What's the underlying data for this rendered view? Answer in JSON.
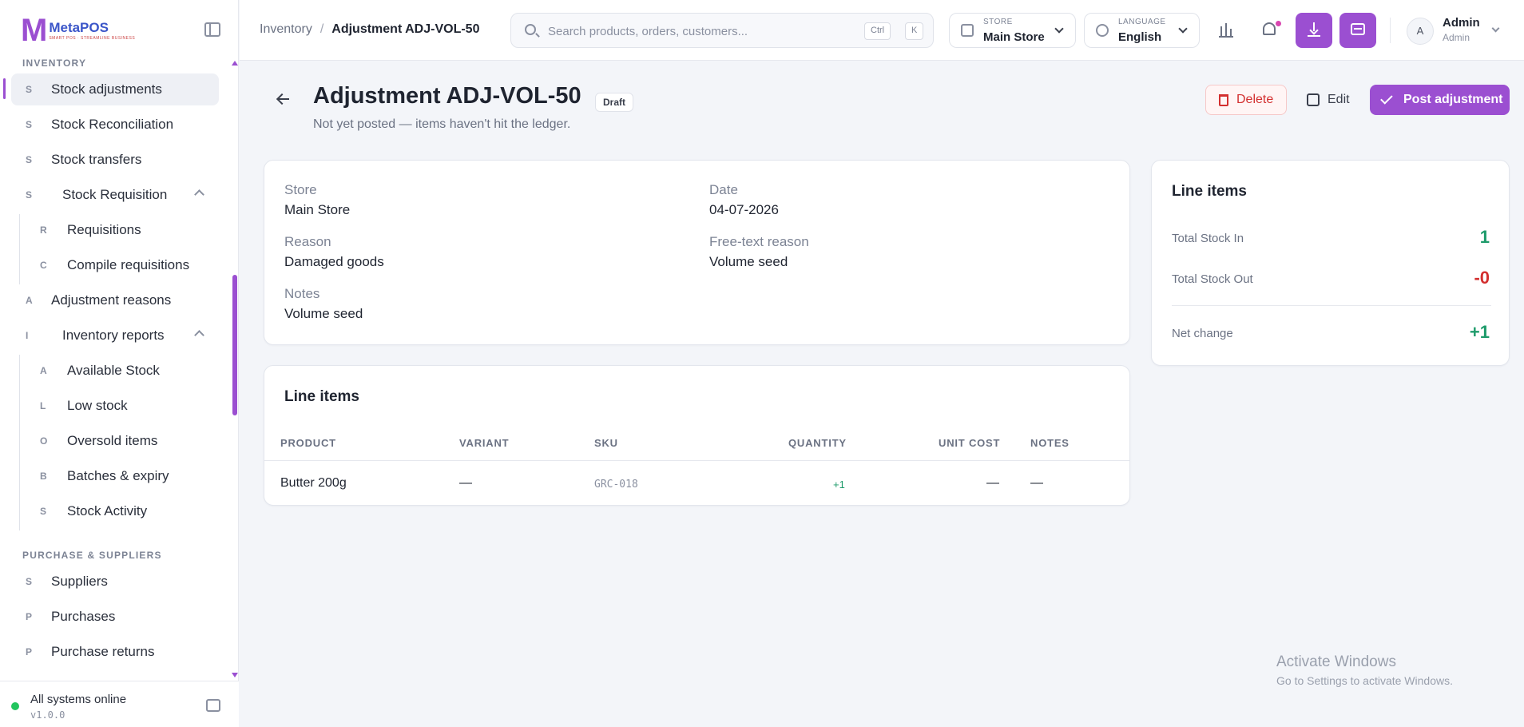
{
  "app": {
    "brand": "MetaPOS",
    "brand_tagline": "SMART POS · STREAMLINE BUSINESS",
    "logo_mark": "M"
  },
  "sidebar": {
    "section_inventory": "INVENTORY",
    "items": [
      {
        "letter": "S",
        "label": "Stock adjustments"
      },
      {
        "letter": "S",
        "label": "Stock Reconciliation"
      },
      {
        "letter": "S",
        "label": "Stock transfers"
      },
      {
        "letter": "S",
        "label": "Stock Requisition"
      },
      {
        "letter": "R",
        "label": "Requisitions"
      },
      {
        "letter": "C",
        "label": "Compile requisitions"
      },
      {
        "letter": "A",
        "label": "Adjustment reasons"
      },
      {
        "letter": "I",
        "label": "Inventory reports"
      },
      {
        "letter": "A",
        "label": "Available Stock"
      },
      {
        "letter": "L",
        "label": "Low stock"
      },
      {
        "letter": "O",
        "label": "Oversold items"
      },
      {
        "letter": "B",
        "label": "Batches & expiry"
      },
      {
        "letter": "S",
        "label": "Stock Activity"
      }
    ],
    "section_purchase": "PURCHASE & SUPPLIERS",
    "purchase_items": [
      {
        "letter": "S",
        "label": "Suppliers"
      },
      {
        "letter": "P",
        "label": "Purchases"
      },
      {
        "letter": "P",
        "label": "Purchase returns"
      }
    ],
    "status_label": "All systems online",
    "version": "v1.0.0"
  },
  "header": {
    "breadcrumb_parent": "Inventory",
    "breadcrumb_sep": "/",
    "breadcrumb_current": "Adjustment ADJ-VOL-50",
    "search_placeholder": "Search products, orders, customers...",
    "kbd_ctrl": "Ctrl",
    "kbd_k": "K",
    "store_label": "STORE",
    "store_value": "Main Store",
    "language_label": "LANGUAGE",
    "language_value": "English",
    "user_initial": "A",
    "user_name": "Admin",
    "user_role": "Admin"
  },
  "page": {
    "title": "Adjustment ADJ-VOL-50",
    "status_badge": "Draft",
    "subtitle": "Not yet posted — items haven't hit the ledger.",
    "delete_label": "Delete",
    "edit_label": "Edit",
    "post_label": "Post adjustment"
  },
  "details": {
    "store_label": "Store",
    "store_value": "Main Store",
    "date_label": "Date",
    "date_value": "04-07-2026",
    "reason_label": "Reason",
    "reason_value": "Damaged goods",
    "freetext_label": "Free-text reason",
    "freetext_value": "Volume seed",
    "notes_label": "Notes",
    "notes_value": "Volume seed"
  },
  "line_items": {
    "title": "Line items",
    "columns": [
      "PRODUCT",
      "VARIANT",
      "SKU",
      "QUANTITY",
      "UNIT COST",
      "NOTES"
    ],
    "rows": [
      {
        "product": "Butter 200g",
        "variant": "—",
        "sku": "GRC-018",
        "quantity": "+1",
        "unit_cost": "—",
        "notes": "—"
      }
    ]
  },
  "summary": {
    "title": "Line items",
    "stock_in_label": "Total Stock In",
    "stock_in_value": "1",
    "stock_out_label": "Total Stock Out",
    "stock_out_value": "-0",
    "net_label": "Net change",
    "net_value": "+1",
    "colors": {
      "positive": "#1e9b6b",
      "negative": "#d32f2f"
    }
  },
  "watermark": {
    "title": "Activate Windows",
    "subtitle": "Go to Settings to activate Windows."
  },
  "colors": {
    "accent": "#9b4fd1",
    "status_online": "#22c55e"
  }
}
